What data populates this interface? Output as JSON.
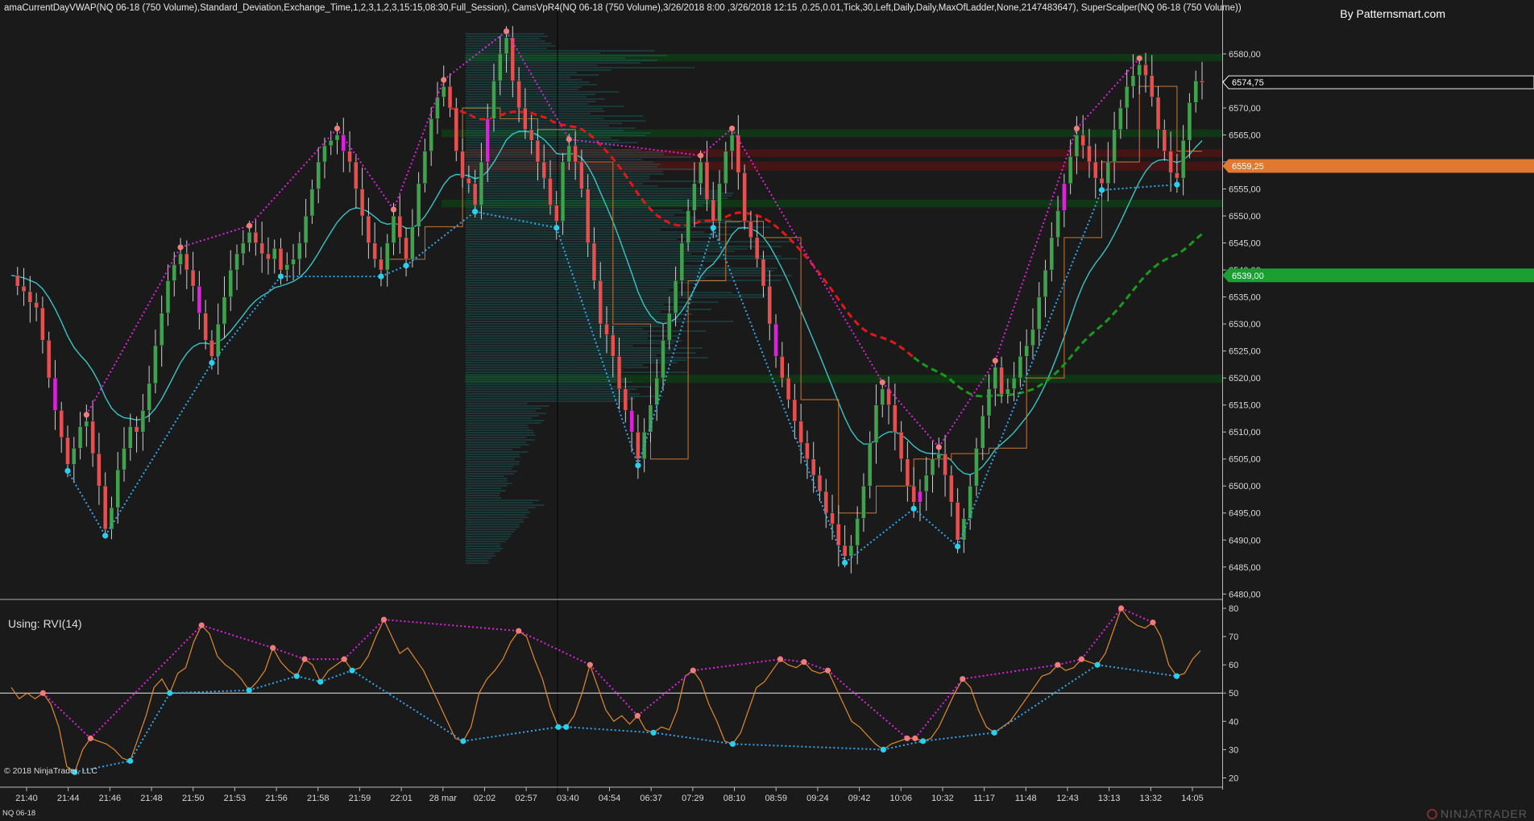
{
  "window": {
    "indicator_header": "amaCurrentDayVWAP(NQ 06-18 (750 Volume),Standard_Deviation,Exchange_Time,1,2,3,1,2,3,15:15,08:30,Full_Session), CamsVpR4(NQ 06-18 (750 Volume),3/26/2018 8:00 ,3/26/2018 12:15 ,0.25,0.01,Tick,30,Left,Daily,Daily,MaxOfLadder,None,2147483647), SuperScalper(NQ 06-18 (750 Volume))",
    "branding": "By Patternsmart.com",
    "copyright": "© 2018 NinjaTrader, LLC",
    "instrument": "NQ 06-18",
    "logo_text": "NINJATRADER",
    "rvi_label": "Using:  RVI(14)"
  },
  "colors": {
    "background": "#1a1a1a",
    "bull_candle": "#3fa34d",
    "bear_candle": "#e85050",
    "highlight_candle": "#e020e0",
    "vwap_line": "#35c6c6",
    "step_line": "#c87833",
    "ma_red": "#e01818",
    "ma_green": "#1a9a1a",
    "rvi_line": "#e08a28",
    "peak_dot": "#f07c7c",
    "trough_dot": "#28d0f0",
    "magenta_dotted": "#e020e0",
    "blue_dotted": "#2ea8f0",
    "current_price_tag": "#f0f0f0",
    "orange_tag": "#e07830",
    "green_tag": "#18a030"
  },
  "chart_data": [
    {
      "type": "candlestick",
      "name": "NQ 06-18 (750 Volume)",
      "y_ticks": [
        "6580,00",
        "6575,00",
        "6570,00",
        "6565,00",
        "6560,00",
        "6555,00",
        "6550,00",
        "6545,00",
        "6540,00",
        "6535,00",
        "6530,00",
        "6525,00",
        "6520,00",
        "6515,00",
        "6510,00",
        "6505,00",
        "6500,00",
        "6495,00",
        "6490,00",
        "6485,00",
        "6480,00"
      ],
      "ylim": [
        6479,
        6587
      ],
      "price_flags": [
        {
          "label": "6574,75",
          "value": 6574.75,
          "style": "current"
        },
        {
          "label": "6559,25",
          "value": 6559.25,
          "style": "orange"
        },
        {
          "label": "6539,00",
          "value": 6539.0,
          "style": "green"
        }
      ],
      "zones": [
        {
          "kind": "green",
          "from": 6578.6,
          "to": 6580.0
        },
        {
          "kind": "red",
          "from": 6558.4,
          "to": 6560.1
        },
        {
          "kind": "red",
          "from": 6560.9,
          "to": 6562.3
        },
        {
          "kind": "green",
          "from": 6564.6,
          "to": 6566.0
        },
        {
          "kind": "green",
          "from": 6551.6,
          "to": 6553.0
        },
        {
          "kind": "green",
          "from": 6519.1,
          "to": 6520.6
        }
      ],
      "series": [
        {
          "name": "price",
          "values": [
            6539,
            6537,
            6536,
            6534,
            6533,
            6527,
            6520,
            6514,
            6509,
            6504,
            6507,
            6511,
            6512,
            6506,
            6500,
            6492,
            6496,
            6503,
            6507,
            6511,
            6510,
            6514,
            6519,
            6526,
            6532,
            6538,
            6541,
            6543,
            6540,
            6537,
            6532,
            6527,
            6524,
            6530,
            6535,
            6540,
            6543,
            6545,
            6547,
            6545,
            6543,
            6542,
            6544,
            6540,
            6541,
            6542,
            6545,
            6550,
            6555,
            6560,
            6563,
            6564,
            6565,
            6562,
            6560,
            6555,
            6550,
            6545,
            6542,
            6540,
            6545,
            6550,
            6546,
            6542,
            6548,
            6556,
            6562,
            6568,
            6572,
            6574,
            6570,
            6562,
            6557,
            6556,
            6552,
            6560,
            6568,
            6575,
            6580,
            6583,
            6575,
            6570,
            6566,
            6564,
            6560,
            6557,
            6552,
            6549,
            6560,
            6563,
            6560,
            6555,
            6545,
            6538,
            6530,
            6528,
            6524,
            6518,
            6514,
            6510,
            6505,
            6510,
            6515,
            6520,
            6527,
            6532,
            6538,
            6545,
            6551,
            6556,
            6560,
            6553,
            6549,
            6556,
            6562,
            6565,
            6558,
            6549,
            6546,
            6542,
            6537,
            6530,
            6524,
            6520,
            6516,
            6512,
            6508,
            6505,
            6502,
            6499,
            6495,
            6493,
            6489,
            6487,
            6489,
            6494,
            6500,
            6508,
            6515,
            6518,
            6515,
            6510,
            6505,
            6500,
            6497,
            6499,
            6502,
            6505,
            6506,
            6502,
            6497,
            6490,
            6494,
            6500,
            6507,
            6513,
            6518,
            6522,
            6517,
            6518,
            6520,
            6524,
            6526,
            6529,
            6535,
            6540,
            6546,
            6551,
            6556,
            6561,
            6565,
            6563,
            6560,
            6557,
            6556,
            6560,
            6566,
            6570,
            6574,
            6576,
            6578,
            6576,
            6572,
            6566,
            6562,
            6558,
            6557,
            6564,
            6571,
            6575,
            6574.75
          ]
        },
        {
          "name": "RVI(14)",
          "values": [
            52,
            48,
            50,
            48,
            50,
            46,
            38,
            24,
            22,
            30,
            34,
            33,
            32,
            30,
            27,
            26,
            34,
            42,
            52,
            55,
            50,
            57,
            59,
            68,
            74,
            71,
            63,
            60,
            58,
            55,
            51,
            54,
            58,
            66,
            61,
            58,
            56,
            62,
            60,
            54,
            58,
            60,
            62,
            58,
            59,
            63,
            70,
            76,
            70,
            64,
            66,
            62,
            58,
            52,
            46,
            40,
            34,
            33,
            38,
            50,
            55,
            58,
            62,
            68,
            72,
            70,
            62,
            55,
            45,
            38,
            38,
            42,
            50,
            60,
            52,
            44,
            40,
            42,
            39,
            42,
            37,
            36,
            38,
            37,
            44,
            56,
            58,
            54,
            46,
            40,
            33,
            32,
            36,
            44,
            52,
            54,
            58,
            62,
            60,
            59,
            61,
            58,
            57,
            58,
            52,
            46,
            40,
            38,
            35,
            32,
            30,
            32,
            33,
            34,
            34,
            33,
            34,
            38,
            44,
            50,
            55,
            52,
            44,
            38,
            36,
            38,
            40,
            44,
            48,
            52,
            56,
            57,
            60,
            58,
            59,
            62,
            61,
            60,
            64,
            72,
            80,
            76,
            74,
            73,
            75,
            70,
            60,
            56,
            57,
            62,
            65
          ]
        }
      ],
      "x_tick_labels": [
        "21:40",
        "21:44",
        "21:46",
        "21:48",
        "21:50",
        "21:53",
        "21:56",
        "21:58",
        "21:59",
        "22:01",
        "28 mar",
        "02:02",
        "02:57",
        "03:40",
        "04:54",
        "06:37",
        "07:29",
        "08:10",
        "08:59",
        "09:24",
        "09:42",
        "10:06",
        "10:32",
        "11:17",
        "11:48",
        "12:43",
        "13:13",
        "13:32",
        "14:05"
      ]
    },
    {
      "type": "line",
      "name": "RVI(14)",
      "y_ticks": [
        "80",
        "70",
        "60",
        "50",
        "40",
        "30",
        "20"
      ],
      "ylim": [
        17,
        82
      ],
      "reference_line": 50
    }
  ]
}
